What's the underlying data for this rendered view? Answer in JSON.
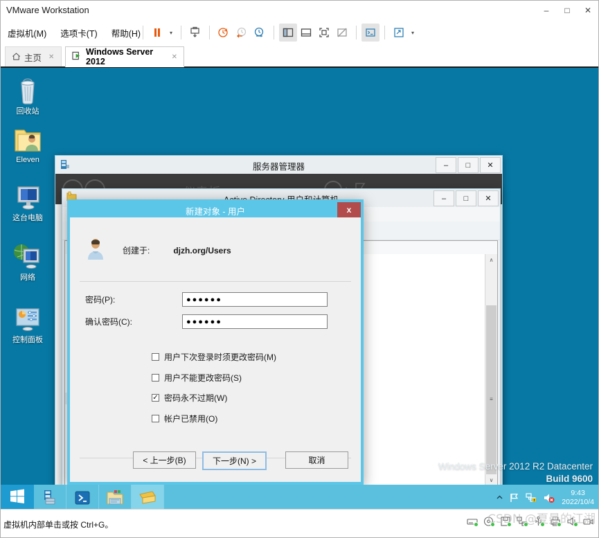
{
  "window": {
    "title": "VMware Workstation",
    "controls": {
      "minimize": "–",
      "maximize": "□",
      "close": "✕"
    }
  },
  "menubar": {
    "items": [
      {
        "label": "虚拟机(M)"
      },
      {
        "label": "选项卡(T)"
      },
      {
        "label": "帮助(H)"
      }
    ]
  },
  "toolbar": {
    "pause_icon": "pause-icon",
    "pause_caret": "▾",
    "snapshot_icon": "take-snapshot-icon",
    "snapshot_manage_icon": "snapshot-icon",
    "revert_icon": "revert-snapshot-icon",
    "snapshot_manager_icon": "snapshot-manager-icon",
    "sidebar_icon": "show-library-icon",
    "thumbnail_icon": "thumbnail-bar-icon",
    "fullscreen_icon": "full-screen-icon",
    "unity_icon": "unity-mode-icon",
    "console_icon": "console-view-icon",
    "stretch_icon": "stretch-guest-icon",
    "stretch_caret": "▾"
  },
  "tabs": [
    {
      "label": "主页",
      "icon": "home-icon",
      "close": "✕",
      "active": false
    },
    {
      "label": "Windows Server 2012",
      "icon": "vm-power-icon",
      "close": "✕",
      "active": true
    }
  ],
  "desktop": {
    "icons": [
      {
        "label": "回收站",
        "icon": "recycle-bin-icon"
      },
      {
        "label": "Eleven",
        "icon": "user-folder-icon"
      },
      {
        "label": "这台电脑",
        "icon": "this-pc-icon"
      },
      {
        "label": "网络",
        "icon": "network-icon"
      },
      {
        "label": "控制面板",
        "icon": "control-panel-icon"
      }
    ],
    "watermark_line1": "Windows Server 2012 R2 Datacenter",
    "watermark_line2": "Build 9600"
  },
  "server_manager": {
    "title": "服务器管理器",
    "icon": "server-manager-icon",
    "nav_back": "‹",
    "nav_fwd": "›",
    "dashboard_hint": "仪表板",
    "controls": {
      "minimize": "–",
      "maximize": "□",
      "close": "✕"
    }
  },
  "aduc": {
    "title": "Active Directory 用户和计算机",
    "icon": "aduc-icon",
    "controls": {
      "minimize": "–",
      "maximize": "□",
      "close": "✕"
    },
    "scroll_up": "∧",
    "scroll_down": "∨",
    "scroll_thumb": "≡"
  },
  "dialog": {
    "title": "新建对象 - 用户",
    "close_label": "x",
    "user_icon": "user-avatar-icon",
    "created_in_label": "创建于:",
    "created_in_value": "djzh.org/Users",
    "fields": [
      {
        "label": "密码(P):",
        "value": "●●●●●●",
        "name": "password-field"
      },
      {
        "label": "确认密码(C):",
        "value": "●●●●●●",
        "name": "confirm-password-field"
      }
    ],
    "checkboxes": [
      {
        "label": "用户下次登录时须更改密码(M)",
        "checked": false
      },
      {
        "label": "用户不能更改密码(S)",
        "checked": false
      },
      {
        "label": "密码永不过期(W)",
        "checked": true
      },
      {
        "label": "帐户已禁用(O)",
        "checked": false
      }
    ],
    "check_glyph": "✓",
    "buttons": [
      {
        "label": "< 上一步(B)",
        "name": "back-button",
        "default": false
      },
      {
        "label": "下一步(N) >",
        "name": "next-button",
        "default": true
      },
      {
        "label": "取消",
        "name": "cancel-button",
        "default": false
      }
    ]
  },
  "taskbar": {
    "start_icon": "windows-start-icon",
    "items": [
      {
        "icon": "server-manager-taskbar-icon",
        "active": false
      },
      {
        "icon": "powershell-icon",
        "active": false
      },
      {
        "icon": "file-explorer-icon",
        "active": false
      },
      {
        "icon": "aduc-taskbar-icon",
        "active": true
      }
    ],
    "tray": {
      "expand_icon": "show-hidden-icons-icon",
      "flag_icon": "action-center-flag-icon",
      "network_icon": "network-warning-icon",
      "volume_icon": "volume-muted-icon",
      "time": "9:43",
      "date": "2022/10/4"
    }
  },
  "statusbar": {
    "message": "虚拟机内部单击或按 Ctrl+G。",
    "icons": [
      {
        "name": "hard-disk-icon"
      },
      {
        "name": "cd-dvd-icon"
      },
      {
        "name": "floppy-icon"
      },
      {
        "name": "network-adapter-icon"
      },
      {
        "name": "usb-icon"
      },
      {
        "name": "printer-icon"
      },
      {
        "name": "sound-card-icon"
      },
      {
        "name": "camera-icon"
      }
    ]
  },
  "watermark": {
    "text": "CSDN @夏曼的江湖"
  },
  "colors": {
    "desktop": "#0778a4",
    "dialog_title": "#5cc6e8",
    "taskbar": "#5bc0de",
    "vmware_orange": "#e8590c"
  }
}
